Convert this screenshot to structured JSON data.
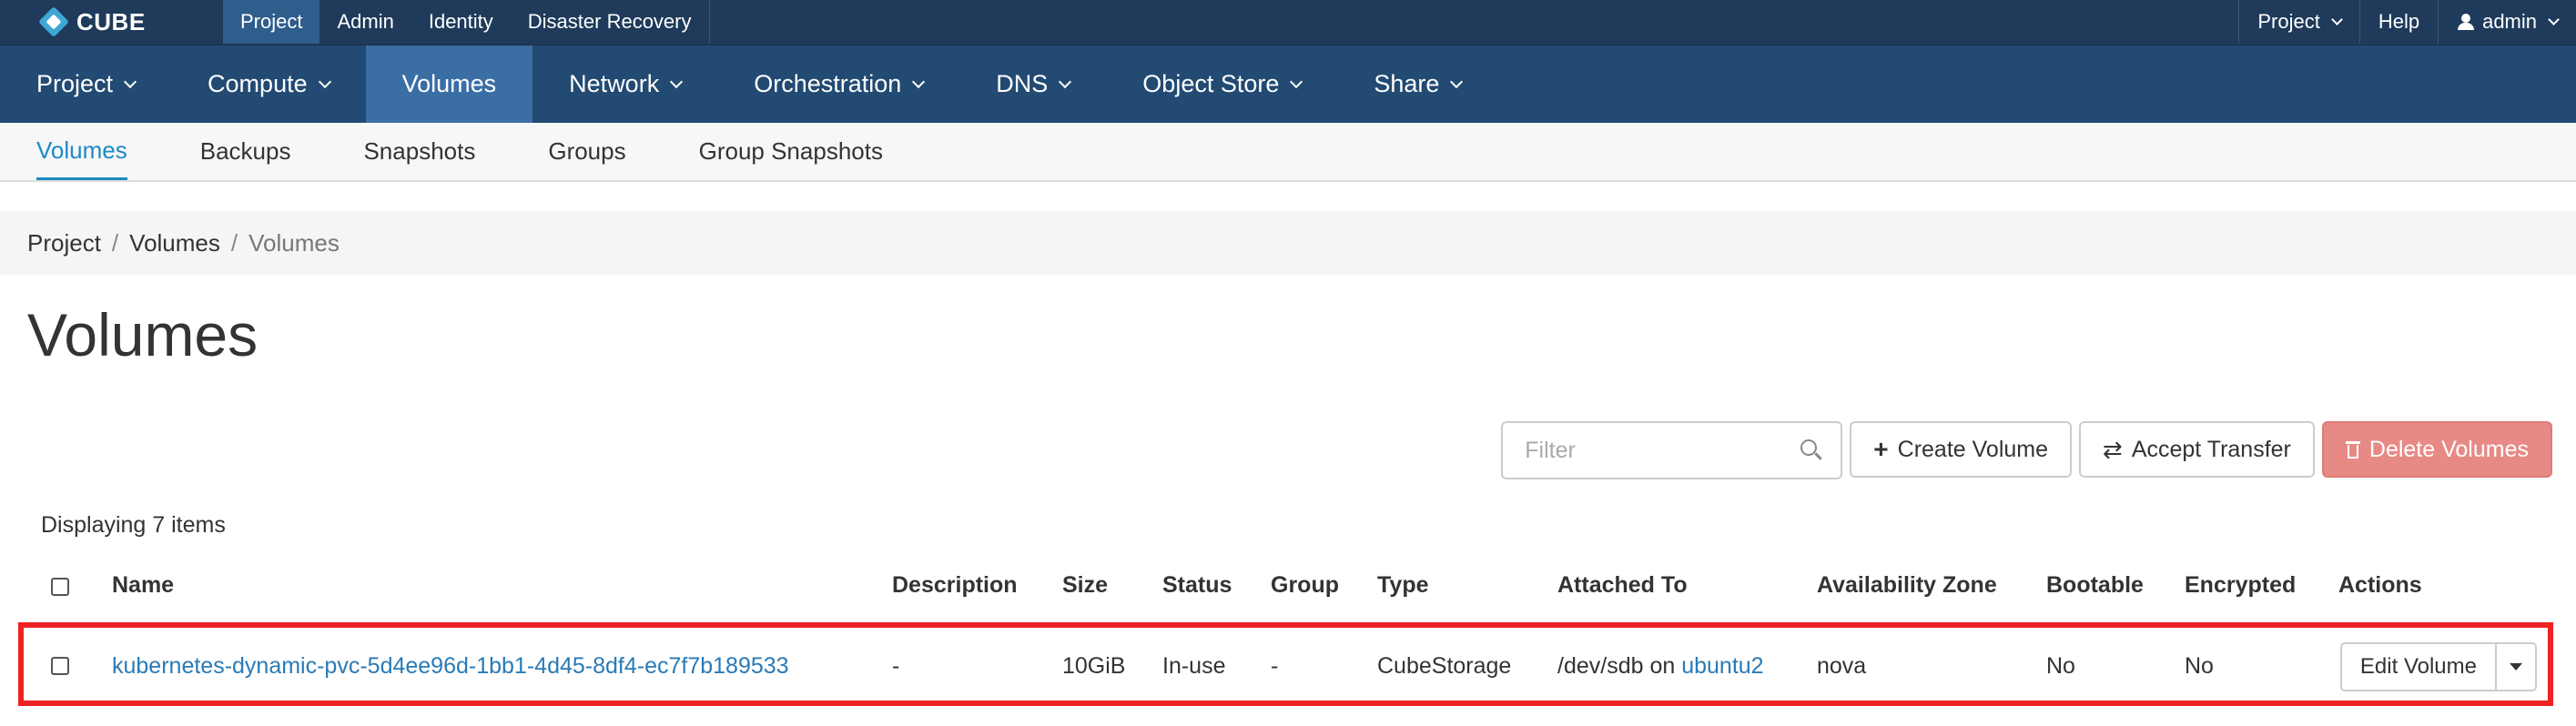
{
  "brand": {
    "name": "CUBE"
  },
  "topnav": [
    "Project",
    "Admin",
    "Identity",
    "Disaster Recovery"
  ],
  "topright": {
    "project": "Project",
    "help": "Help",
    "user": "admin"
  },
  "mainnav": [
    "Project",
    "Compute",
    "Volumes",
    "Network",
    "Orchestration",
    "DNS",
    "Object Store",
    "Share"
  ],
  "subnav": [
    "Volumes",
    "Backups",
    "Snapshots",
    "Groups",
    "Group Snapshots"
  ],
  "breadcrumb": [
    "Project",
    "Volumes",
    "Volumes"
  ],
  "page_title": "Volumes",
  "filter": {
    "placeholder": "Filter"
  },
  "buttons": {
    "create": "Create Volume",
    "accept": "Accept Transfer",
    "delete": "Delete Volumes"
  },
  "count_text": "Displaying 7 items",
  "columns": [
    "Name",
    "Description",
    "Size",
    "Status",
    "Group",
    "Type",
    "Attached To",
    "Availability Zone",
    "Bootable",
    "Encrypted",
    "Actions"
  ],
  "row": {
    "name": "kubernetes-dynamic-pvc-5d4ee96d-1bb1-4d45-8df4-ec7f7b189533",
    "description": "-",
    "size": "10GiB",
    "status": "In-use",
    "group": "-",
    "type": "CubeStorage",
    "attached_prefix": "/dev/sdb on",
    "attached_host": "ubuntu2",
    "zone": "nova",
    "bootable": "No",
    "encrypted": "No",
    "action": "Edit Volume"
  },
  "colors": {
    "topbar": "#1f3a5a",
    "mainnav": "#224a72",
    "active": "#3a6ea5",
    "link": "#2a7ab7",
    "highlight": "#ee2222",
    "danger": "#e78a86"
  }
}
